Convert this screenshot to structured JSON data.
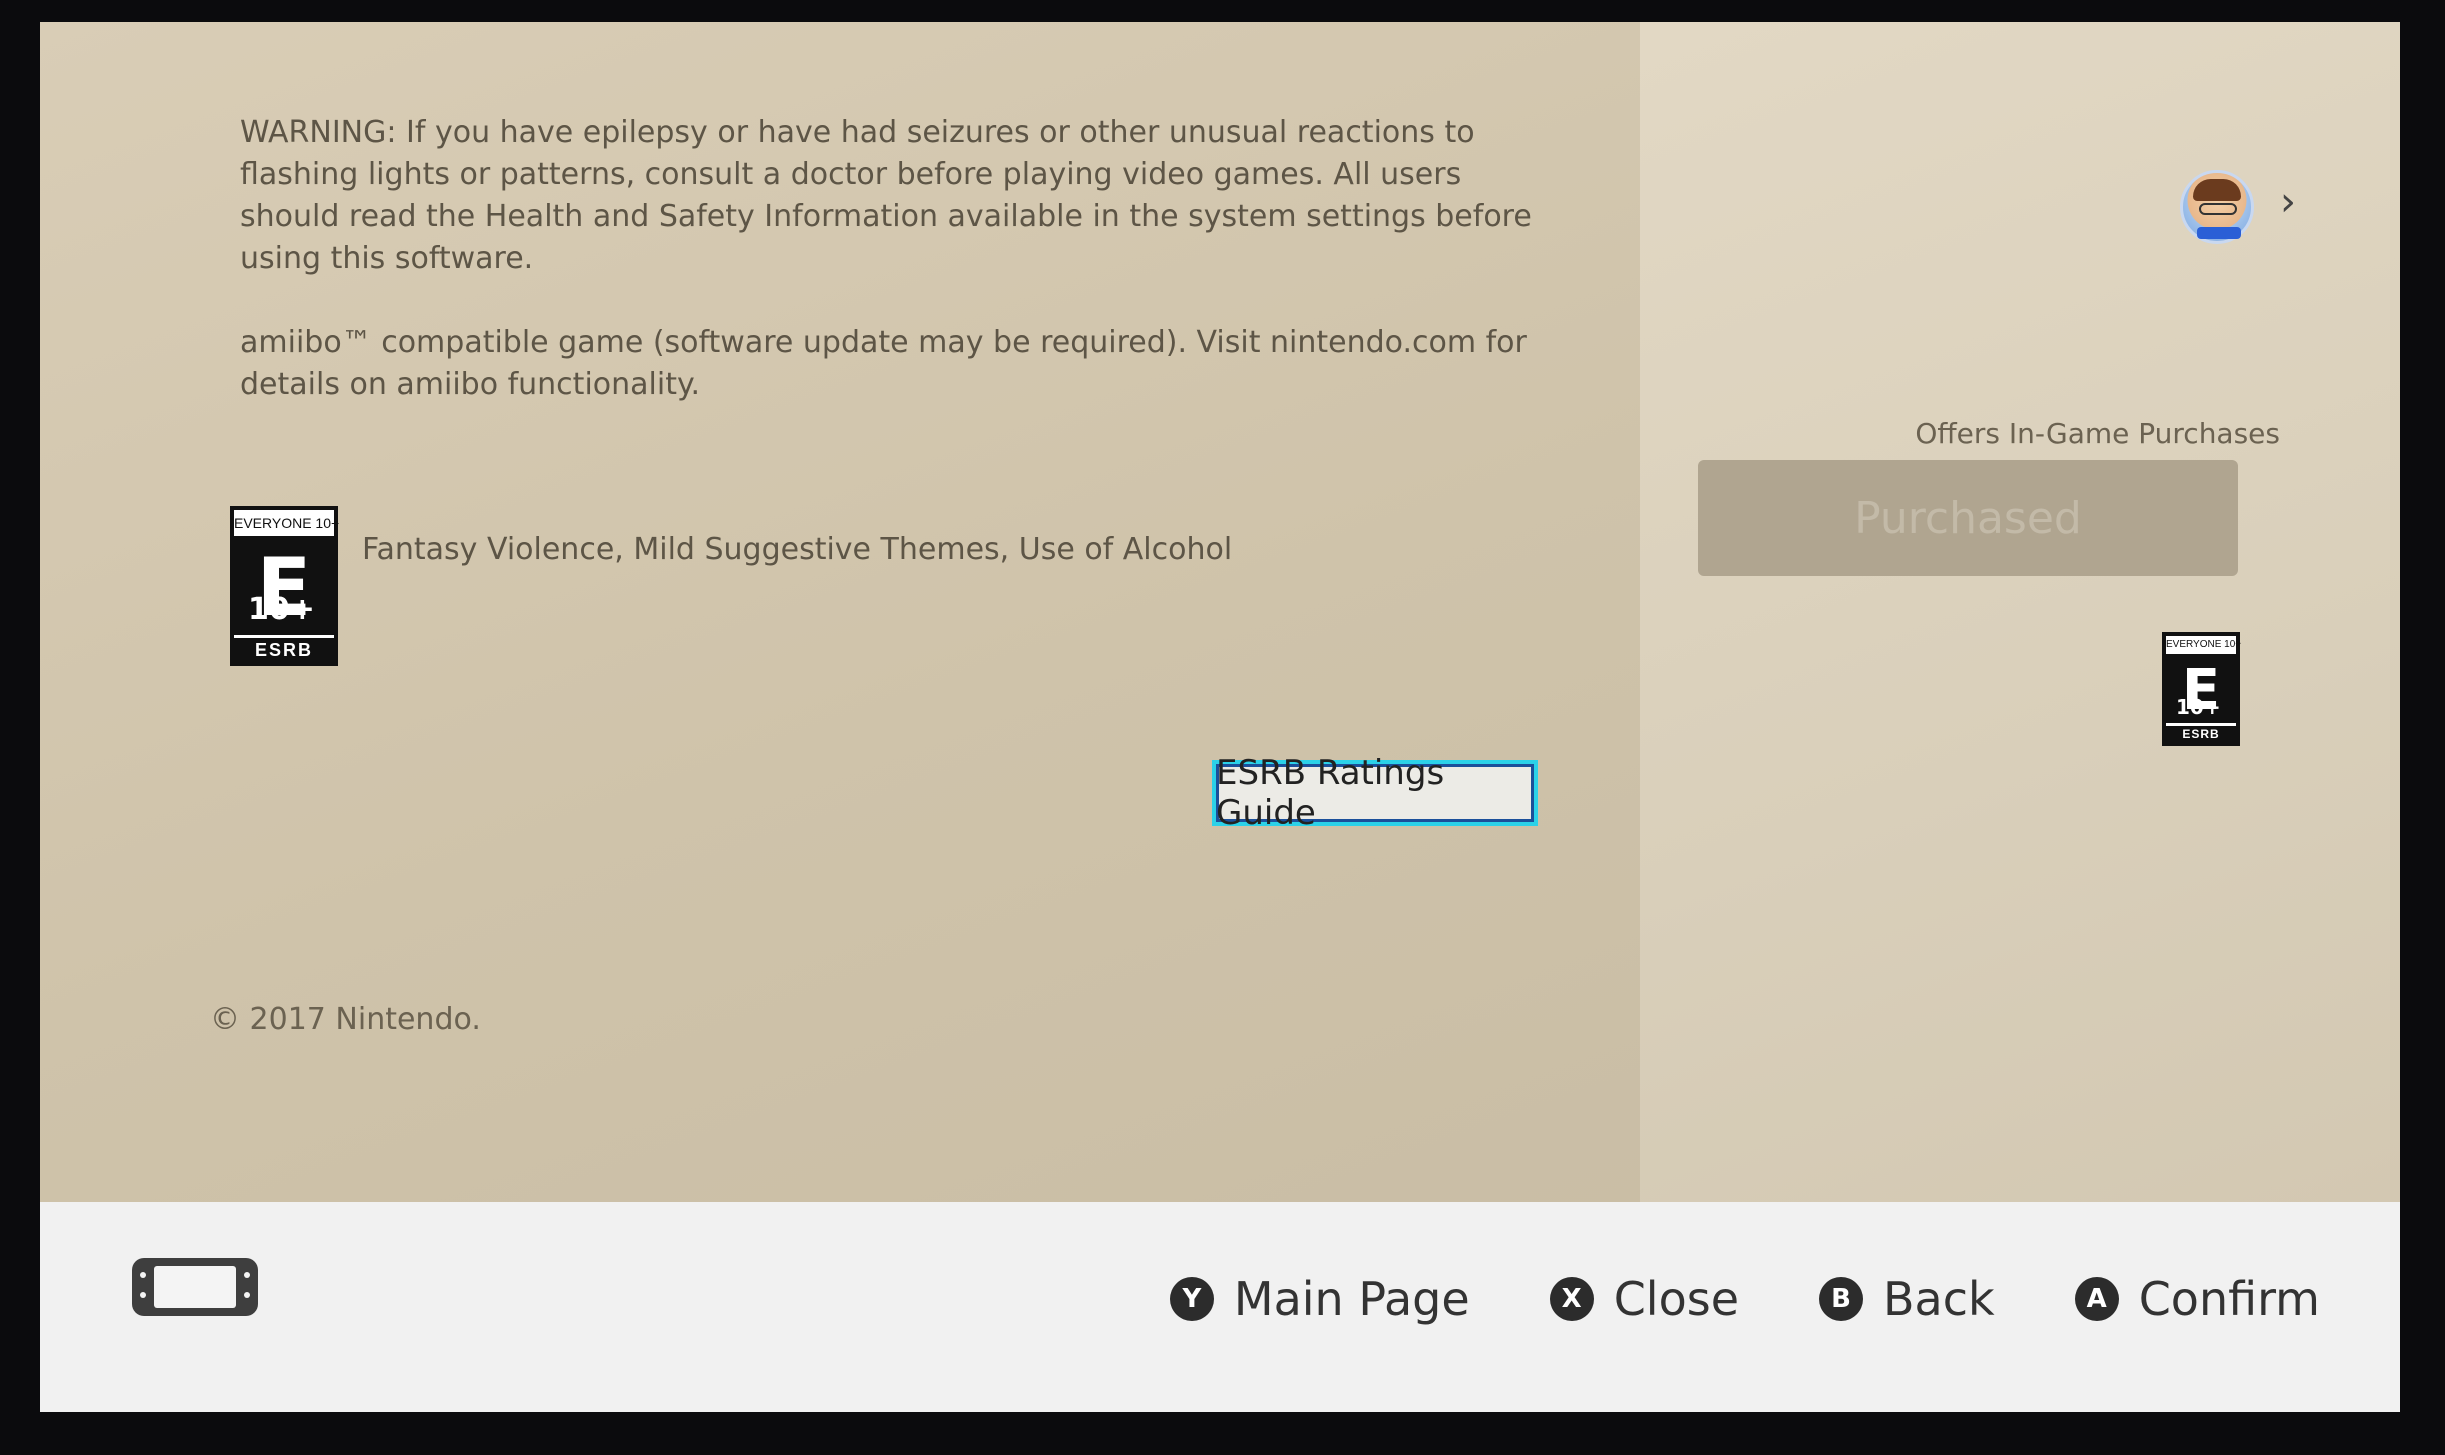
{
  "info": {
    "warning": "WARNING: If you have epilepsy or have had seizures or other unusual reactions to flashing lights or patterns, consult a doctor before playing video games. All users should read the Health and Safety Information available in the system settings before using this software.",
    "amiibo": "amiibo™ compatible game (software update may be required). Visit nintendo.com for details on amiibo functionality.",
    "descriptors": "Fantasy Violence, Mild Suggestive Themes, Use of Alcohol",
    "ratings_guide_label": "ESRB Ratings Guide",
    "copyright": "© 2017 Nintendo."
  },
  "esrb": {
    "header": "EVERYONE 10+",
    "letter": "E",
    "age": "10+",
    "footer": "ESRB"
  },
  "side": {
    "offers": "Offers In-Game Purchases",
    "purchased_label": "Purchased",
    "chevron": "›"
  },
  "footer": {
    "actions": [
      {
        "key": "Y",
        "label": "Main Page"
      },
      {
        "key": "X",
        "label": "Close"
      },
      {
        "key": "B",
        "label": "Back"
      },
      {
        "key": "A",
        "label": "Confirm"
      }
    ]
  },
  "icons": {
    "avatar": "user-avatar",
    "console": "console-handheld-icon"
  }
}
